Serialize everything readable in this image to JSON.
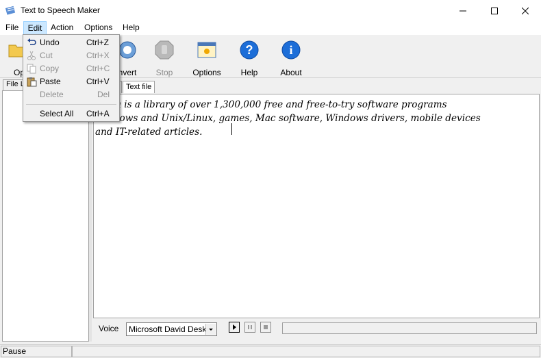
{
  "window": {
    "title": "Text to Speech Maker",
    "controls": {
      "minimize": "—",
      "maximize": "☐",
      "close": "✕"
    }
  },
  "menubar": {
    "file": "File",
    "edit": "Edit",
    "action": "Action",
    "options": "Options",
    "help": "Help"
  },
  "toolbar": {
    "open_label": "Op",
    "convert_label": "nvert",
    "stop_label": "Stop",
    "options_label": "Options",
    "help_label": "Help",
    "about_label": "About"
  },
  "edit_menu": {
    "undo": {
      "label": "Undo",
      "shortcut": "Ctrl+Z",
      "enabled": true
    },
    "cut": {
      "label": "Cut",
      "shortcut": "Ctrl+X",
      "enabled": false
    },
    "copy": {
      "label": "Copy",
      "shortcut": "Ctrl+C",
      "enabled": false
    },
    "paste": {
      "label": "Paste",
      "shortcut": "Ctrl+V",
      "enabled": true
    },
    "delete": {
      "label": "Delete",
      "shortcut": "Del",
      "enabled": false
    },
    "select_all": {
      "label": "Select All",
      "shortcut": "Ctrl+A",
      "enabled": true
    }
  },
  "left_panel": {
    "tab_label": "File L"
  },
  "editor": {
    "tab_label": "Text file",
    "lines": [
      "pedia is a library of over 1,300,000 free and free-to-try software programs",
      "Windows and Unix/Linux, games, Mac software, Windows drivers, mobile devices",
      "and IT-related articles."
    ]
  },
  "voice": {
    "label": "Voice",
    "selected": "Microsoft David Desktop"
  },
  "statusbar": {
    "status": "Pause"
  },
  "colors": {
    "menu_highlight": "#cce8ff",
    "help_blue": "#1d6ed8",
    "window_bg": "#f0f0f0"
  }
}
